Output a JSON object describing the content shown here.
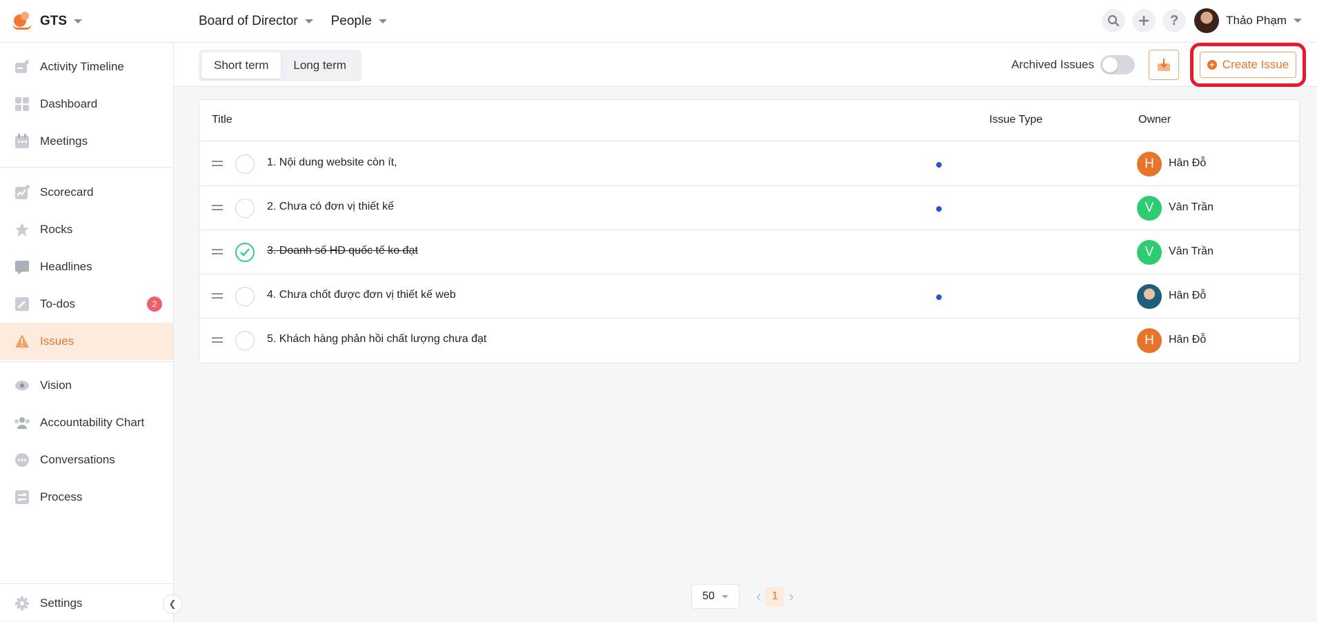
{
  "app": {
    "name": "GTS"
  },
  "breadcrumbs": [
    {
      "label": "Board of Director"
    },
    {
      "label": "People"
    }
  ],
  "user": {
    "name": "Thảo Phạm"
  },
  "sidebar": {
    "items": [
      {
        "label": "Activity Timeline"
      },
      {
        "label": "Dashboard"
      },
      {
        "label": "Meetings"
      },
      {
        "label": "Scorecard"
      },
      {
        "label": "Rocks"
      },
      {
        "label": "Headlines"
      },
      {
        "label": "To-dos",
        "badge": "2"
      },
      {
        "label": "Issues"
      },
      {
        "label": "Vision"
      },
      {
        "label": "Accountability Chart"
      },
      {
        "label": "Conversations"
      },
      {
        "label": "Process"
      }
    ],
    "settings_label": "Settings"
  },
  "toolbar": {
    "tabs": [
      {
        "label": "Short term"
      },
      {
        "label": "Long term"
      }
    ],
    "archived_label": "Archived Issues",
    "create_label": "Create Issue"
  },
  "table": {
    "headers": {
      "title": "Title",
      "type": "Issue Type",
      "owner": "Owner"
    },
    "rows": [
      {
        "title": "1. Nội dung website còn ít,",
        "owner": "Hân Đỗ",
        "avatar": "H"
      },
      {
        "title": "2. Chưa có đơn vị thiết kế",
        "owner": "Vân Trần",
        "avatar": "V"
      },
      {
        "title": "3. Doanh số HD quốc tế ko đạt",
        "owner": "Vân Trần",
        "avatar": "V"
      },
      {
        "title": "4. Chưa chốt được đơn vị thiết kế web",
        "owner": "Hân Đỗ",
        "avatar": ""
      },
      {
        "title": "5. Khách hàng phản hồi chất lượng chưa đạt",
        "owner": "Hân Đỗ",
        "avatar": "H"
      }
    ]
  },
  "pagination": {
    "per_page": "50",
    "current_page": "1"
  },
  "colors": {
    "accent": "#e8732b",
    "highlight": "#e8192c",
    "green": "#2ecc71",
    "dot": "#2753d6"
  }
}
